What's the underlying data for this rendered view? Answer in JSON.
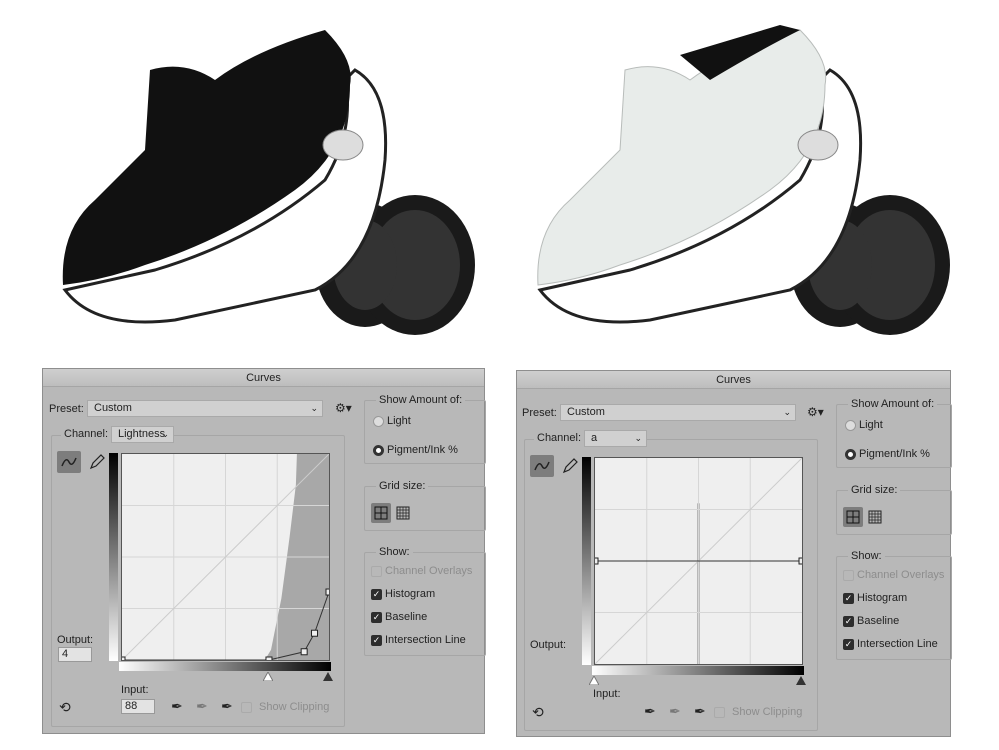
{
  "photos": [
    {
      "name": "black-shoes",
      "knit_color": "#111111",
      "sole_color": "#ffffff",
      "tread_color": "#1a1a1a"
    },
    {
      "name": "white-shoes",
      "knit_color": "#e8ecea",
      "sole_color": "#ffffff",
      "tread_color": "#1a1a1a"
    }
  ],
  "panels": [
    {
      "title": "Curves",
      "preset_label": "Preset:",
      "preset_value": "Custom",
      "channel_label": "Channel:",
      "channel_value": "Lightness",
      "output_label": "Output:",
      "output_value": "4",
      "input_label": "Input:",
      "input_value": "88",
      "show_amount_label": "Show Amount of:",
      "light_label": "Light",
      "pigment_label": "Pigment/Ink %",
      "pigment_selected": true,
      "grid_size_label": "Grid size:",
      "show_label": "Show:",
      "channel_overlays_label": "Channel Overlays",
      "channel_overlays_checked": false,
      "histogram_label": "Histogram",
      "histogram_checked": true,
      "baseline_label": "Baseline",
      "baseline_checked": true,
      "intersection_label": "Intersection Line",
      "intersection_checked": true,
      "show_clipping_label": "Show Clipping",
      "show_clipping_checked": false,
      "curve_points": [
        [
          0,
          0
        ],
        [
          71,
          0
        ],
        [
          88,
          4
        ],
        [
          93,
          13
        ],
        [
          100,
          33
        ]
      ],
      "white_slider": 71,
      "black_slider": 100
    },
    {
      "title": "Curves",
      "preset_label": "Preset:",
      "preset_value": "Custom",
      "channel_label": "Channel:",
      "channel_value": "a",
      "output_label": "Output:",
      "input_label": "Input:",
      "show_amount_label": "Show Amount of:",
      "light_label": "Light",
      "pigment_label": "Pigment/Ink %",
      "pigment_selected": true,
      "grid_size_label": "Grid size:",
      "show_label": "Show:",
      "channel_overlays_label": "Channel Overlays",
      "channel_overlays_checked": false,
      "histogram_label": "Histogram",
      "histogram_checked": true,
      "baseline_label": "Baseline",
      "baseline_checked": true,
      "intersection_label": "Intersection Line",
      "intersection_checked": true,
      "show_clipping_label": "Show Clipping",
      "show_clipping_checked": false,
      "curve_points": [
        [
          0,
          50
        ],
        [
          100,
          50
        ]
      ],
      "white_slider": 0,
      "black_slider": 100
    }
  ]
}
